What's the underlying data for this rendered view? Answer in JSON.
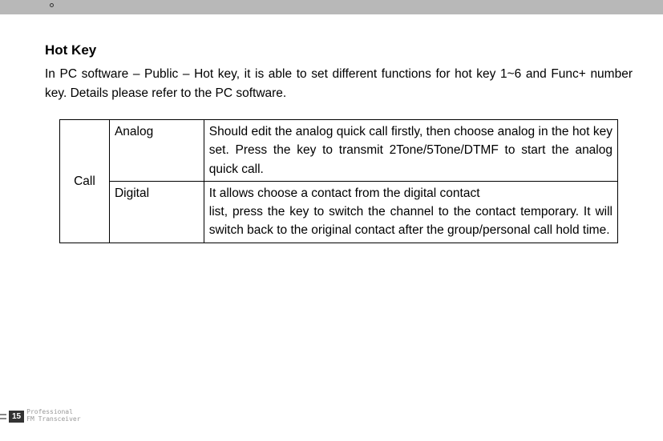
{
  "title": "Hot Key",
  "intro": "In PC software – Public – Hot key, it is able to set different functions for hot key 1~6 and Func+ number key. Details please refer to the PC software.",
  "table": {
    "rowspan_label": "Call",
    "rows": [
      {
        "mode": "Analog",
        "desc": "Should edit the analog quick call firstly, then choose analog in the hot key set. Press the key to transmit 2Tone/5Tone/DTMF to start the analog quick call."
      },
      {
        "mode": "Digital",
        "desc_line1": "It allows choose a contact from the digital contact",
        "desc_line2": "list, press the key to switch the channel to the contact temporary. It will switch back to the original contact after the group/personal call hold time."
      }
    ]
  },
  "footer": {
    "page": "15",
    "line1": "Professional",
    "line2": "FM Transceiver"
  }
}
